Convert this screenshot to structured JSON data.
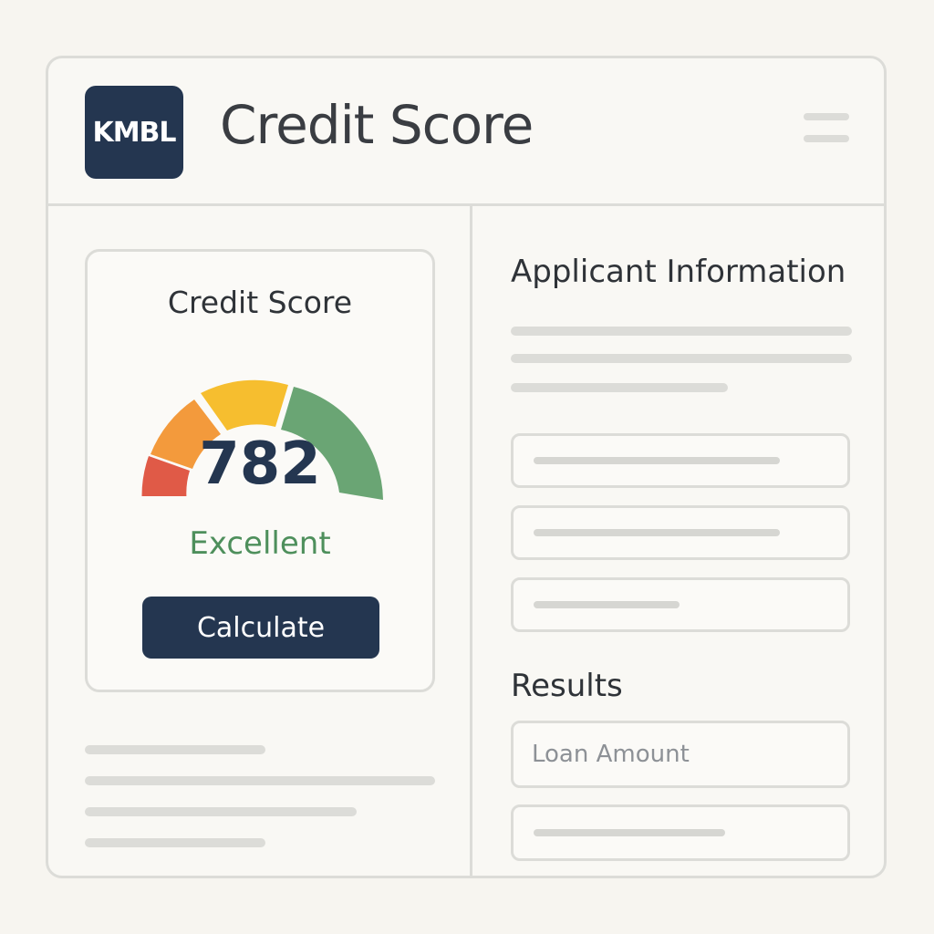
{
  "header": {
    "logo_text": "KMBL",
    "title": "Credit Score",
    "menu_icon": "hamburger-menu-icon"
  },
  "score_card": {
    "title": "Credit Score",
    "score": "782",
    "rating": "Excellent",
    "calculate_label": "Calculate",
    "gauge_colors": [
      "#e05a47",
      "#f39a3c",
      "#f6be2f",
      "#6aa574"
    ],
    "rating_color": "#4e8f5c"
  },
  "applicant": {
    "title": "Applicant Information"
  },
  "results": {
    "title": "Results",
    "loan_amount_placeholder": "Loan Amount"
  },
  "colors": {
    "primary": "#243650",
    "border": "#dcdcd8",
    "background": "#f7f5f0"
  }
}
